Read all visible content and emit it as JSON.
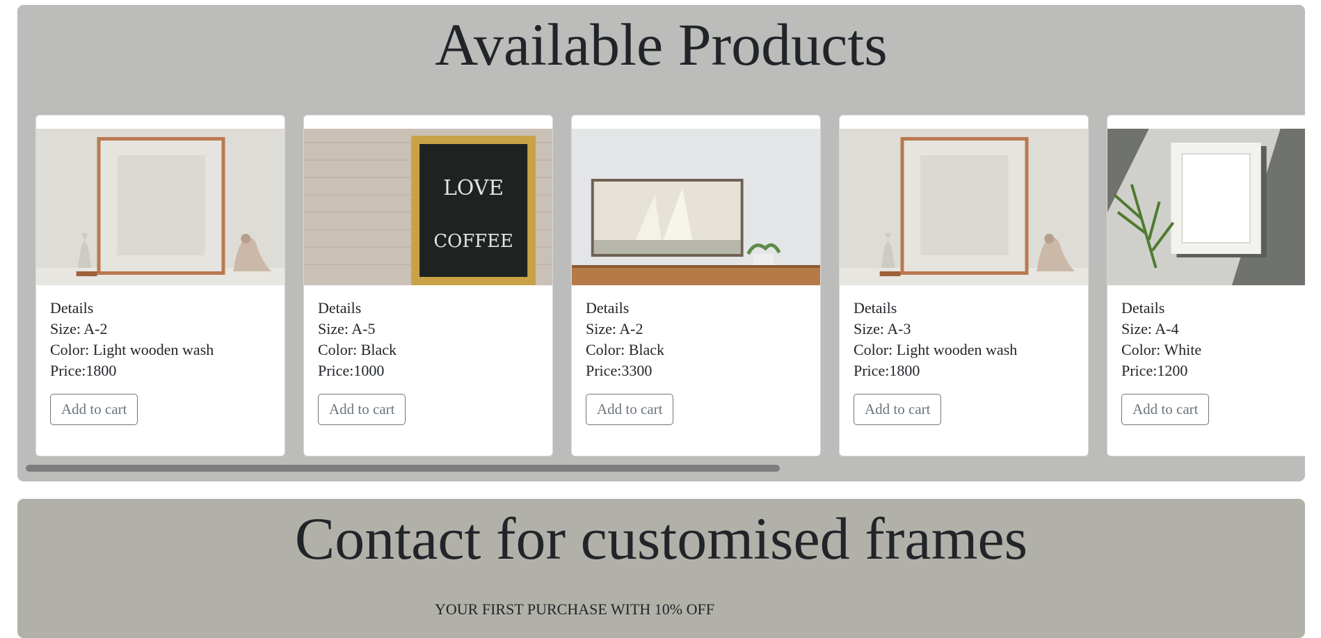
{
  "products_section": {
    "title": "Available Products",
    "items": [
      {
        "image": "copper-frame-with-hourglass-and-rocking-horse",
        "details": "Details",
        "size": "Size: A-2",
        "color": "Color: Light wooden wash",
        "price": "Price:1800",
        "button": "Add to cart"
      },
      {
        "image": "gold-frame-love-coffee-chalkboard",
        "details": "Details",
        "size": "Size: A-5",
        "color": "Color: Black",
        "price": "Price:1000",
        "button": "Add to cart"
      },
      {
        "image": "sailboat-painting-over-wooden-console",
        "details": "Details",
        "size": "Size: A-2",
        "color": "Color: Black",
        "price": "Price:3300",
        "button": "Add to cart"
      },
      {
        "image": "copper-frame-with-hourglass-and-rocking-horse",
        "details": "Details",
        "size": "Size: A-3",
        "color": "Color: Light wooden wash",
        "price": "Price:1800",
        "button": "Add to cart"
      },
      {
        "image": "white-frame-with-palm-leaf-shadow",
        "details": "Details",
        "size": "Size: A-4",
        "color": "Color: White",
        "price": "Price:1200",
        "button": "Add to cart"
      }
    ]
  },
  "contact_section": {
    "title": "Contact for customised frames",
    "promo": "YOUR FIRST PURCHASE WITH 10% OFF"
  },
  "colors": {
    "products_bg": "#bcbcba",
    "contact_bg": "#b2b1a9",
    "button_border": "#6c757d",
    "text": "#212529"
  }
}
